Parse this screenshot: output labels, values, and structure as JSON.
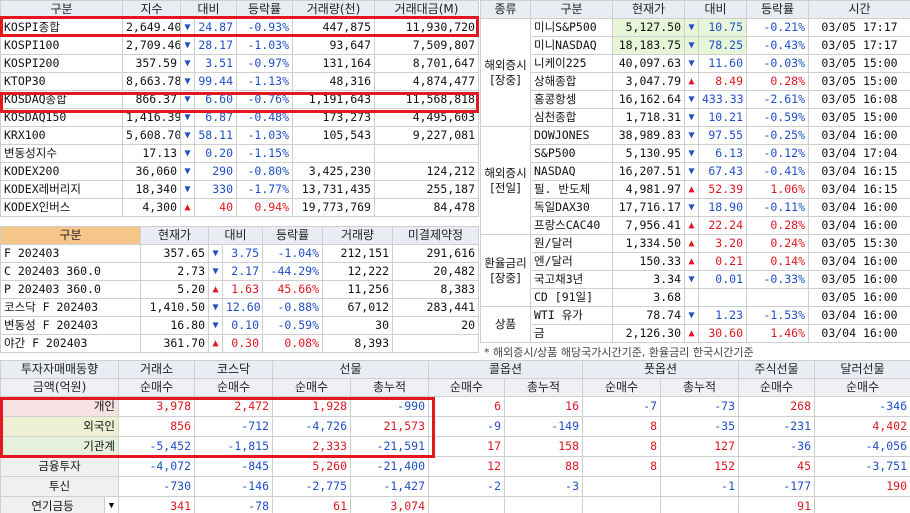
{
  "domestic": {
    "headers": [
      "구분",
      "지수",
      "대비",
      "등락률",
      "거래량(천)",
      "거래대금(M)"
    ],
    "rows": [
      {
        "name": "KOSPI종합",
        "value": "2,649.40",
        "dir": "▼",
        "change": "24.87",
        "rate": "-0.93%",
        "volume": "447,875",
        "amount": "11,930,720",
        "tone": "dn"
      },
      {
        "name": "KOSPI100",
        "value": "2,709.46",
        "dir": "▼",
        "change": "28.17",
        "rate": "-1.03%",
        "volume": "93,647",
        "amount": "7,509,807",
        "tone": "dn"
      },
      {
        "name": "KOSPI200",
        "value": "357.59",
        "dir": "▼",
        "change": "3.51",
        "rate": "-0.97%",
        "volume": "131,164",
        "amount": "8,701,647",
        "tone": "dn"
      },
      {
        "name": "KTOP30",
        "value": "8,663.78",
        "dir": "▼",
        "change": "99.44",
        "rate": "-1.13%",
        "volume": "48,316",
        "amount": "4,874,477",
        "tone": "dn"
      },
      {
        "name": "KOSDAQ종합",
        "value": "866.37",
        "dir": "▼",
        "change": "6.60",
        "rate": "-0.76%",
        "volume": "1,191,643",
        "amount": "11,568,818",
        "tone": "dn"
      },
      {
        "name": "KOSDAQ150",
        "value": "1,416.39",
        "dir": "▼",
        "change": "6.87",
        "rate": "-0.48%",
        "volume": "173,273",
        "amount": "4,495,603",
        "tone": "dn"
      },
      {
        "name": "KRX100",
        "value": "5,608.70",
        "dir": "▼",
        "change": "58.11",
        "rate": "-1.03%",
        "volume": "105,543",
        "amount": "9,227,081",
        "tone": "dn"
      },
      {
        "name": "변동성지수",
        "value": "17.13",
        "dir": "▼",
        "change": "0.20",
        "rate": "-1.15%",
        "volume": "",
        "amount": "",
        "tone": "dn"
      },
      {
        "name": "KODEX200",
        "value": "36,060",
        "dir": "▼",
        "change": "290",
        "rate": "-0.80%",
        "volume": "3,425,230",
        "amount": "124,212",
        "tone": "dn"
      },
      {
        "name": "KODEX레버리지",
        "value": "18,340",
        "dir": "▼",
        "change": "330",
        "rate": "-1.77%",
        "volume": "13,731,435",
        "amount": "255,187",
        "tone": "dn"
      },
      {
        "name": "KODEX인버스",
        "value": "4,300",
        "dir": "▲",
        "change": "40",
        "rate": "0.94%",
        "volume": "19,773,769",
        "amount": "84,478",
        "tone": "up"
      }
    ]
  },
  "futures": {
    "headers": [
      "구분",
      "현재가",
      "대비",
      "등락률",
      "거래량",
      "미결제약정"
    ],
    "rows": [
      {
        "name": "F 202403",
        "value": "357.65",
        "dir": "▼",
        "change": "3.75",
        "rate": "-1.04%",
        "volume": "212,151",
        "oi": "291,616",
        "tone": "dn"
      },
      {
        "name": "C 202403 360.0",
        "value": "2.73",
        "dir": "▼",
        "change": "2.17",
        "rate": "-44.29%",
        "volume": "12,222",
        "oi": "20,482",
        "tone": "dn"
      },
      {
        "name": "P 202403 360.0",
        "value": "5.20",
        "dir": "▲",
        "change": "1.63",
        "rate": "45.66%",
        "volume": "11,256",
        "oi": "8,383",
        "tone": "up"
      },
      {
        "name": "코스닥 F 202403",
        "value": "1,410.50",
        "dir": "▼",
        "change": "12.60",
        "rate": "-0.88%",
        "volume": "67,012",
        "oi": "283,441",
        "tone": "dn"
      },
      {
        "name": "변동성 F 202403",
        "value": "16.80",
        "dir": "▼",
        "change": "0.10",
        "rate": "-0.59%",
        "volume": "30",
        "oi": "20",
        "tone": "dn"
      },
      {
        "name": "야간  F 202403",
        "value": "361.70",
        "dir": "▲",
        "change": "0.30",
        "rate": "0.08%",
        "volume": "8,393",
        "oi": "",
        "tone": "up"
      }
    ]
  },
  "global": {
    "headers": [
      "종류",
      "구분",
      "현재가",
      "대비",
      "등락률",
      "시간"
    ],
    "groups": [
      {
        "label": "해외증시[장중]",
        "rows": [
          {
            "name": "미니S&P500",
            "value": "5,127.50",
            "dir": "▼",
            "change": "10.75",
            "rate": "-0.21%",
            "time": "03/05 17:17",
            "tone": "dn",
            "sel": true
          },
          {
            "name": "미니NASDAQ",
            "value": "18,183.75",
            "dir": "▼",
            "change": "78.25",
            "rate": "-0.43%",
            "time": "03/05 17:17",
            "tone": "dn",
            "sel": true
          },
          {
            "name": "니케이225",
            "value": "40,097.63",
            "dir": "▼",
            "change": "11.60",
            "rate": "-0.03%",
            "time": "03/05 15:00",
            "tone": "dn"
          },
          {
            "name": "상해종합",
            "value": "3,047.79",
            "dir": "▲",
            "change": "8.49",
            "rate": "0.28%",
            "time": "03/05 15:00",
            "tone": "up"
          },
          {
            "name": "홍콩항셍",
            "value": "16,162.64",
            "dir": "▼",
            "change": "433.33",
            "rate": "-2.61%",
            "time": "03/05 16:08",
            "tone": "dn"
          },
          {
            "name": "심천종합",
            "value": "1,718.31",
            "dir": "▼",
            "change": "10.21",
            "rate": "-0.59%",
            "time": "03/05 15:00",
            "tone": "dn"
          }
        ]
      },
      {
        "label": "해외증시[전일]",
        "rows": [
          {
            "name": "DOWJONES",
            "value": "38,989.83",
            "dir": "▼",
            "change": "97.55",
            "rate": "-0.25%",
            "time": "03/04 16:00",
            "tone": "dn"
          },
          {
            "name": "S&P500",
            "value": "5,130.95",
            "dir": "▼",
            "change": "6.13",
            "rate": "-0.12%",
            "time": "03/04 17:04",
            "tone": "dn"
          },
          {
            "name": "NASDAQ",
            "value": "16,207.51",
            "dir": "▼",
            "change": "67.43",
            "rate": "-0.41%",
            "time": "03/04 16:15",
            "tone": "dn"
          },
          {
            "name": "필. 반도체",
            "value": "4,981.97",
            "dir": "▲",
            "change": "52.39",
            "rate": "1.06%",
            "time": "03/04 16:15",
            "tone": "up"
          },
          {
            "name": "독일DAX30",
            "value": "17,716.17",
            "dir": "▼",
            "change": "18.90",
            "rate": "-0.11%",
            "time": "03/04 16:00",
            "tone": "dn"
          },
          {
            "name": "프랑스CAC40",
            "value": "7,956.41",
            "dir": "▲",
            "change": "22.24",
            "rate": "0.28%",
            "time": "03/04 16:00",
            "tone": "up"
          }
        ]
      },
      {
        "label": "환율금리[장중]",
        "rows": [
          {
            "name": "원/달러",
            "value": "1,334.50",
            "dir": "▲",
            "change": "3.20",
            "rate": "0.24%",
            "time": "03/05 15:30",
            "tone": "up"
          },
          {
            "name": "엔/달러",
            "value": "150.33",
            "dir": "▲",
            "change": "0.21",
            "rate": "0.14%",
            "time": "03/04 16:00",
            "tone": "up"
          },
          {
            "name": "국고채3년",
            "value": "3.34",
            "dir": "▼",
            "change": "0.01",
            "rate": "-0.33%",
            "time": "03/05 16:00",
            "tone": "dn"
          },
          {
            "name": "CD [91일]",
            "value": "3.68",
            "dir": "",
            "change": "",
            "rate": "",
            "time": "03/05 16:00",
            "tone": ""
          }
        ]
      },
      {
        "label": "상품",
        "rows": [
          {
            "name": "WTI 유가",
            "value": "78.74",
            "dir": "▼",
            "change": "1.23",
            "rate": "-1.53%",
            "time": "03/04 16:00",
            "tone": "dn"
          },
          {
            "name": "금",
            "value": "2,126.30",
            "dir": "▲",
            "change": "30.60",
            "rate": "1.46%",
            "time": "03/04 16:00",
            "tone": "up"
          }
        ]
      }
    ],
    "note": "* 해외증시/상품 해당국가시간기준, 환율금리 한국시간기준"
  },
  "investors": {
    "title": "투자자매매동향",
    "unit": "금액(억원)",
    "groups": [
      "거래소",
      "코스닥",
      "선물",
      "콜옵션",
      "풋옵션",
      "주식선물",
      "달러선물"
    ],
    "subs": [
      "순매수",
      "순매수",
      "순매수",
      "총누적",
      "순매수",
      "총누적",
      "순매수",
      "총누적",
      "순매수",
      "순매수"
    ],
    "rows": [
      {
        "name": "개인",
        "v": [
          "3,978",
          "2,472",
          "1,928",
          "-990",
          "6",
          "16",
          "-7",
          "-73",
          "268",
          "-346"
        ]
      },
      {
        "name": "외국인",
        "v": [
          "856",
          "-712",
          "-4,726",
          "21,573",
          "-9",
          "-149",
          "8",
          "-35",
          "-231",
          "4,402"
        ]
      },
      {
        "name": "기관계",
        "v": [
          "-5,452",
          "-1,815",
          "2,333",
          "-21,591",
          "17",
          "158",
          "8",
          "127",
          "-36",
          "-4,056"
        ]
      },
      {
        "name": "금융투자",
        "v": [
          "-4,072",
          "-845",
          "5,260",
          "-21,400",
          "12",
          "88",
          "8",
          "152",
          "45",
          "-3,751"
        ]
      },
      {
        "name": "투신",
        "v": [
          "-730",
          "-146",
          "-2,775",
          "-1,427",
          "-2",
          "-3",
          "",
          "-1",
          "-177",
          "190"
        ]
      },
      {
        "name": "연기금등",
        "v": [
          "341",
          "-78",
          "61",
          "3,074",
          "",
          "",
          "",
          "",
          "91",
          ""
        ]
      }
    ]
  },
  "colors": {
    "up": "#e0161f",
    "down": "#1e4fc8",
    "highlight": "#e4161f"
  }
}
